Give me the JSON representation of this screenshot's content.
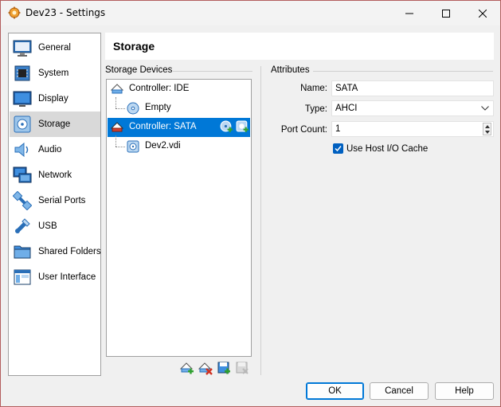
{
  "window": {
    "title": "Dev23 - Settings"
  },
  "sidebar": {
    "items": [
      {
        "label": "General",
        "icon": "general-icon"
      },
      {
        "label": "System",
        "icon": "system-icon"
      },
      {
        "label": "Display",
        "icon": "display-icon"
      },
      {
        "label": "Storage",
        "icon": "storage-icon",
        "selected": true
      },
      {
        "label": "Audio",
        "icon": "audio-icon"
      },
      {
        "label": "Network",
        "icon": "network-icon"
      },
      {
        "label": "Serial Ports",
        "icon": "serial-ports-icon"
      },
      {
        "label": "USB",
        "icon": "usb-icon"
      },
      {
        "label": "Shared Folders",
        "icon": "shared-folders-icon"
      },
      {
        "label": "User Interface",
        "icon": "user-interface-icon"
      }
    ]
  },
  "page": {
    "title": "Storage"
  },
  "storage_devices": {
    "group_label": "Storage Devices",
    "tree": [
      {
        "label": "Controller: IDE",
        "type": "controller"
      },
      {
        "label": "Empty",
        "type": "optical"
      },
      {
        "label": "Controller: SATA",
        "type": "controller",
        "selected": true
      },
      {
        "label": "Dev2.vdi",
        "type": "disk"
      }
    ]
  },
  "attributes": {
    "group_label": "Attributes",
    "name_label": "Name:",
    "name_value": "SATA",
    "type_label": "Type:",
    "type_value": "AHCI",
    "port_count_label": "Port Count:",
    "port_count_value": "1",
    "host_io_cache_label": "Use Host I/O Cache",
    "host_io_cache_checked": true
  },
  "buttons": {
    "ok": "OK",
    "cancel": "Cancel",
    "help": "Help"
  },
  "colors": {
    "selection": "#0078d7",
    "checkbox": "#0060c0"
  }
}
